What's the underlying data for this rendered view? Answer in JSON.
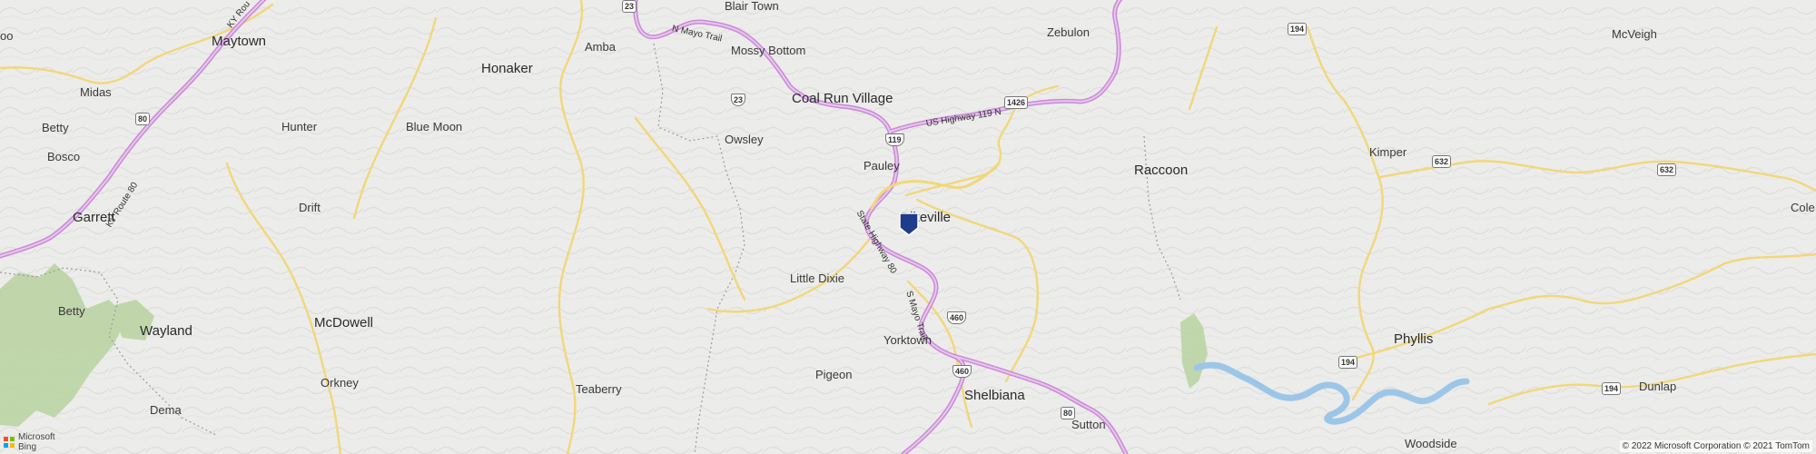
{
  "map": {
    "places": [
      {
        "id": "boo",
        "name": "oo"
      },
      {
        "id": "maytown",
        "name": "Maytown"
      },
      {
        "id": "midas",
        "name": "Midas"
      },
      {
        "id": "betty-top",
        "name": "Betty"
      },
      {
        "id": "bosco",
        "name": "Bosco"
      },
      {
        "id": "garrett",
        "name": "Garrett"
      },
      {
        "id": "hunter",
        "name": "Hunter"
      },
      {
        "id": "drift",
        "name": "Drift"
      },
      {
        "id": "honaker",
        "name": "Honaker"
      },
      {
        "id": "blue-moon",
        "name": "Blue Moon"
      },
      {
        "id": "amba",
        "name": "Amba"
      },
      {
        "id": "blair-town",
        "name": "Blair Town"
      },
      {
        "id": "mossy-bottom",
        "name": "Mossy Bottom"
      },
      {
        "id": "zebulon",
        "name": "Zebulon"
      },
      {
        "id": "coal-run-village",
        "name": "Coal Run Village"
      },
      {
        "id": "owsley",
        "name": "Owsley"
      },
      {
        "id": "pauley",
        "name": "Pauley"
      },
      {
        "id": "pikeville",
        "name": "Pikeville"
      },
      {
        "id": "little-dixie",
        "name": "Little Dixie"
      },
      {
        "id": "raccoon",
        "name": "Raccoon"
      },
      {
        "id": "kimper",
        "name": "Kimper"
      },
      {
        "id": "mcveigh",
        "name": "McVeigh"
      },
      {
        "id": "cole",
        "name": "Cole"
      },
      {
        "id": "betty",
        "name": "Betty"
      },
      {
        "id": "wayland",
        "name": "Wayland"
      },
      {
        "id": "mcdowell",
        "name": "McDowell"
      },
      {
        "id": "orkney",
        "name": "Orkney"
      },
      {
        "id": "dema",
        "name": "Dema"
      },
      {
        "id": "teaberry",
        "name": "Teaberry"
      },
      {
        "id": "yorktown",
        "name": "Yorktown"
      },
      {
        "id": "pigeon",
        "name": "Pigeon"
      },
      {
        "id": "shelbiana",
        "name": "Shelbiana"
      },
      {
        "id": "sutton",
        "name": "Sutton"
      },
      {
        "id": "phyllis",
        "name": "Phyllis"
      },
      {
        "id": "dunlap",
        "name": "Dunlap"
      },
      {
        "id": "woodside",
        "name": "Woodside"
      }
    ],
    "shields": [
      {
        "id": "r23-top",
        "number": "23"
      },
      {
        "id": "r80-left",
        "number": "80"
      },
      {
        "id": "r23-mid",
        "number": "23"
      },
      {
        "id": "r119",
        "number": "119"
      },
      {
        "id": "r1426",
        "number": "1426"
      },
      {
        "id": "r194-top",
        "number": "194"
      },
      {
        "id": "r632-a",
        "number": "632"
      },
      {
        "id": "r632-b",
        "number": "632"
      },
      {
        "id": "r460-a",
        "number": "460"
      },
      {
        "id": "r460-b",
        "number": "460"
      },
      {
        "id": "r80-bottom",
        "number": "80"
      },
      {
        "id": "r194-mid",
        "number": "194"
      },
      {
        "id": "r194-right",
        "number": "194"
      }
    ],
    "road_labels": [
      {
        "id": "ky-route-80",
        "text": "KY Route 80"
      },
      {
        "id": "ky-rou-top",
        "text": "KY Rou"
      },
      {
        "id": "n-mayo-trail",
        "text": "N Mayo Trail"
      },
      {
        "id": "us-highway-119n",
        "text": "US Highway 119 N"
      },
      {
        "id": "state-highway-80",
        "text": "State Highway 80"
      },
      {
        "id": "s-mayo-trail",
        "text": "S Mayo Trail"
      }
    ],
    "attribution": {
      "logo_text_line1": "Microsoft",
      "logo_text_line2": "Bing",
      "copyright": "© 2022 Microsoft Corporation © 2021 TomTom"
    },
    "colors": {
      "background": "#ececea",
      "highway": "#c98ad6",
      "highway_core": "#e8c6ee",
      "secondary_road": "#f2d77a",
      "forest": "#b9d3a0",
      "river": "#9cc6e8",
      "pin": "#1f3b8c"
    },
    "pin": {
      "icon": "location-pin-icon",
      "label": "Pikeville"
    }
  }
}
